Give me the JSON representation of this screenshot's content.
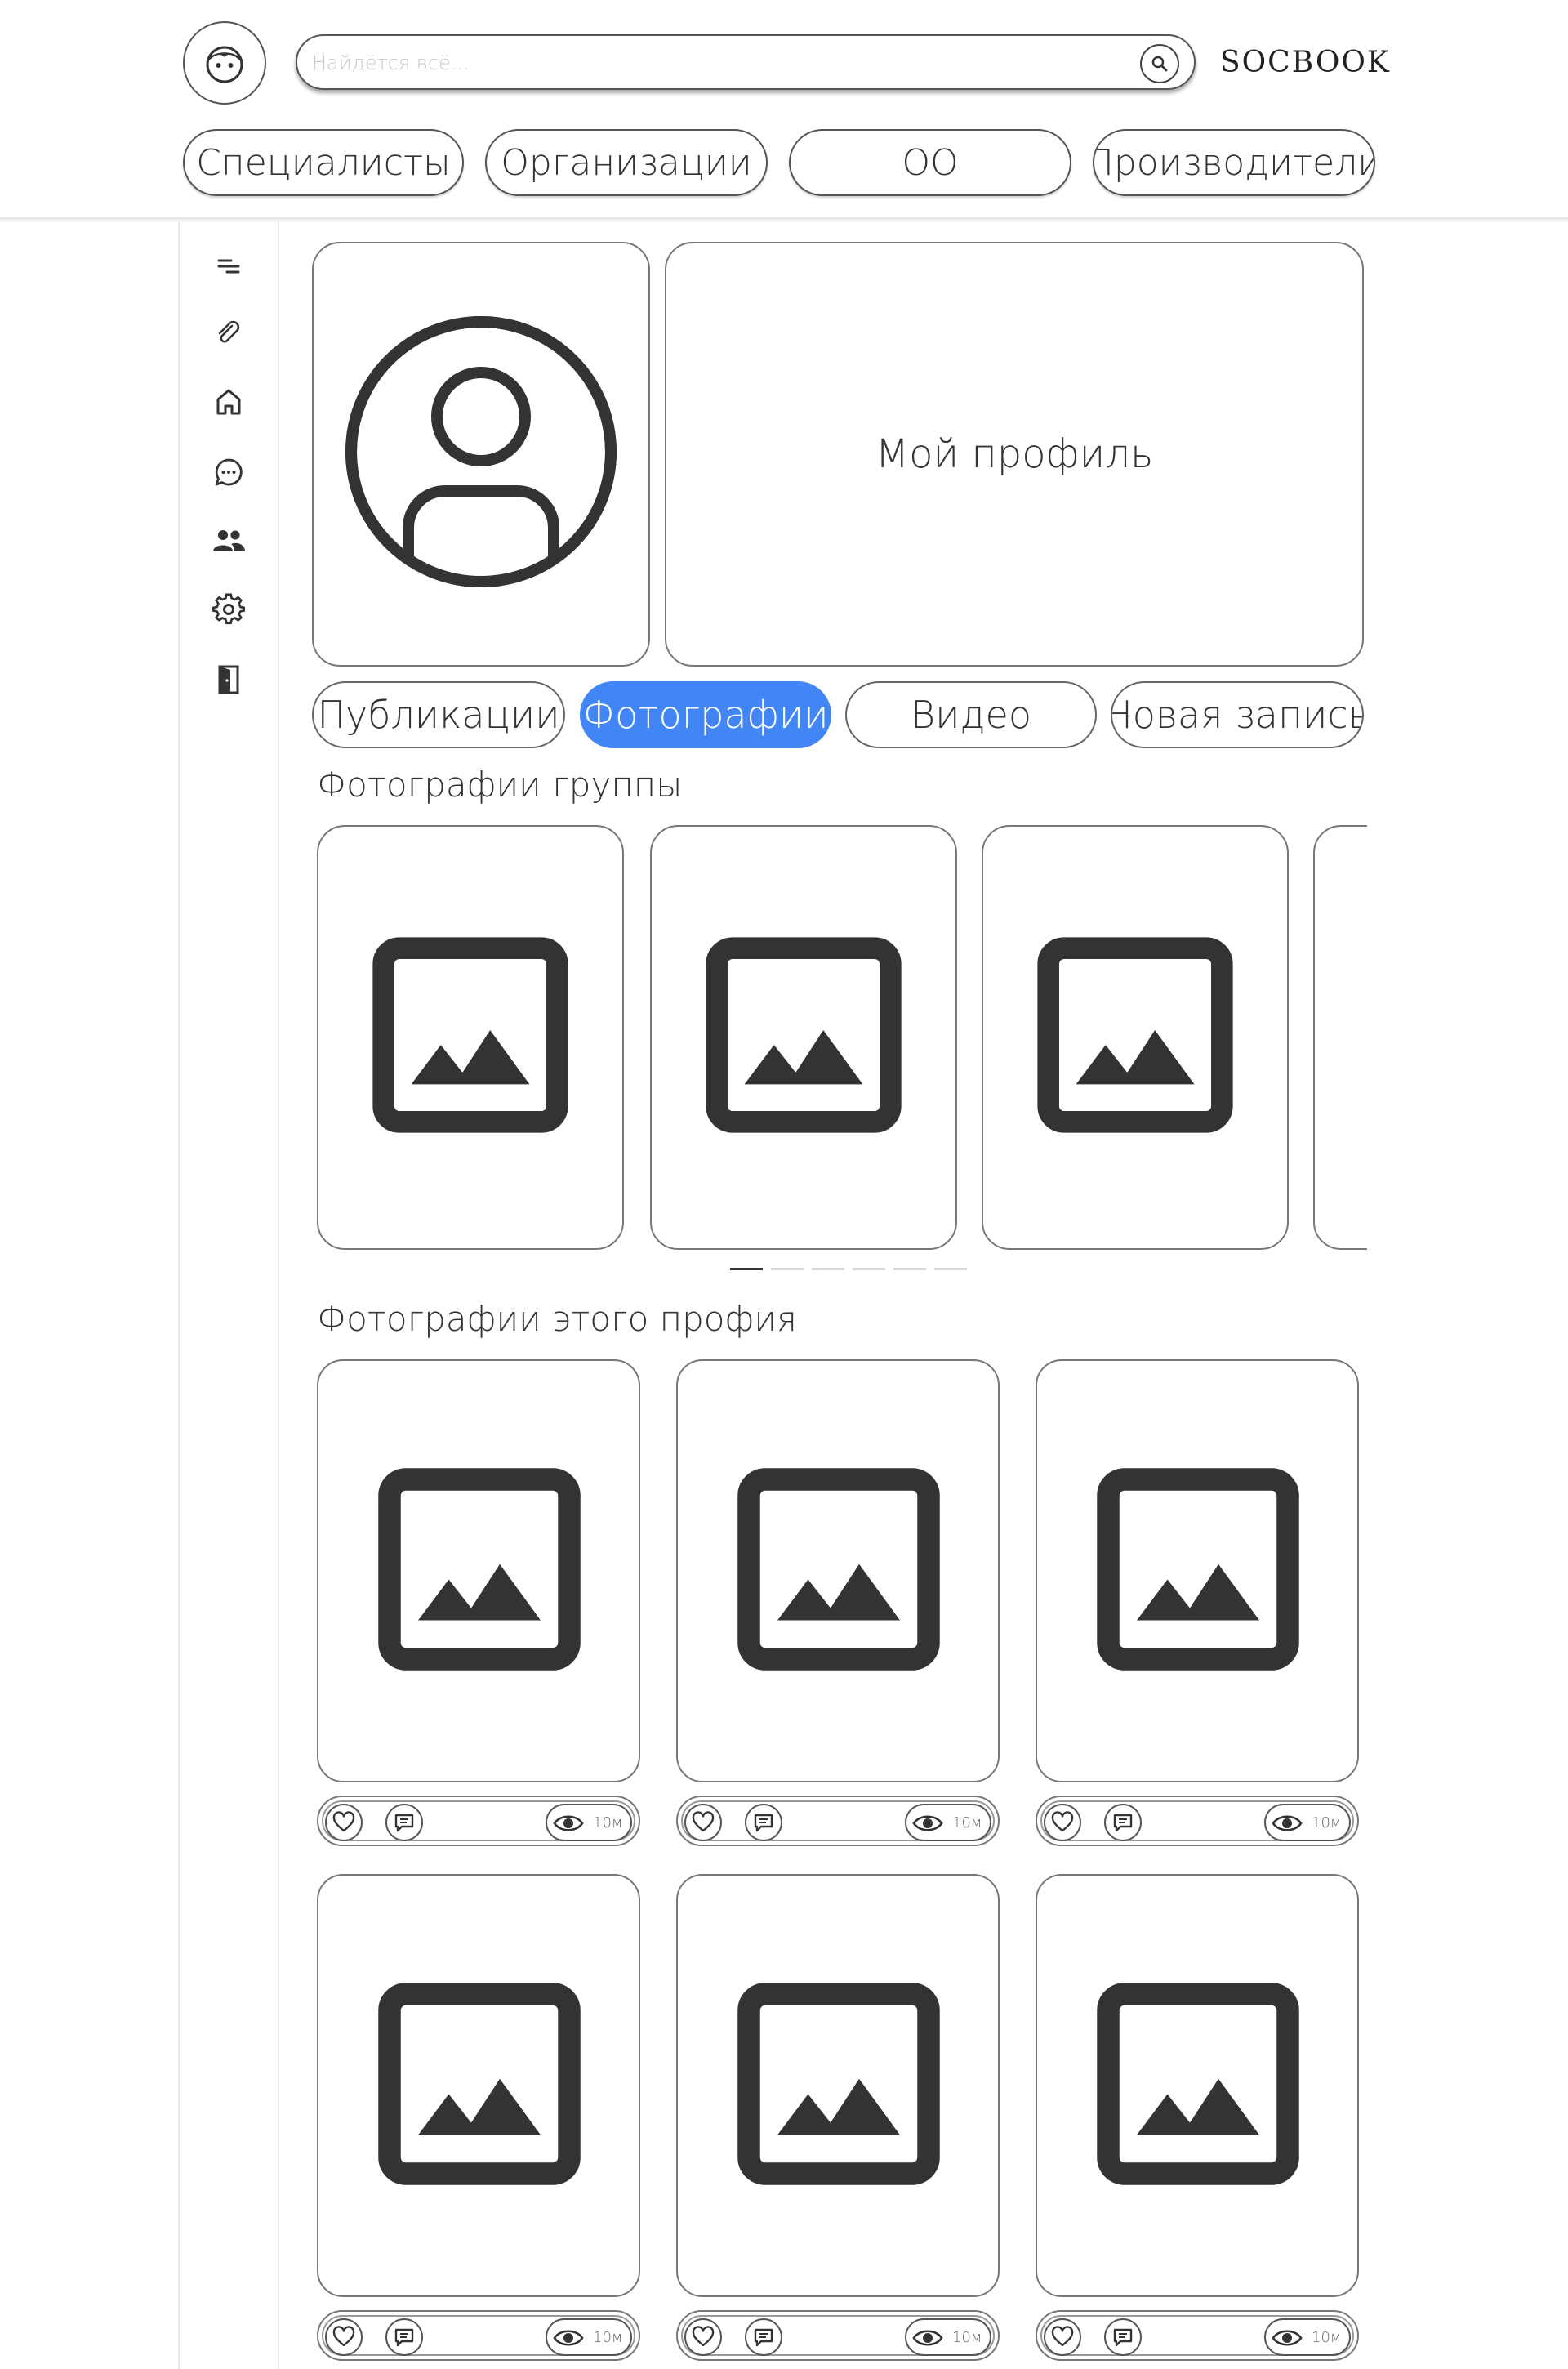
{
  "header": {
    "logo_icon": "face-icon",
    "search_placeholder": "Найдётся всё...",
    "search_icon": "search-icon",
    "brand": "SOCBOOK",
    "categories": [
      "Специалисты",
      "Организации",
      "ОО",
      "Производители"
    ]
  },
  "sidebar": {
    "items": [
      {
        "icon": "menu-lines-icon"
      },
      {
        "icon": "paperclip-icon"
      },
      {
        "icon": "home-icon"
      },
      {
        "icon": "chat-icon"
      },
      {
        "icon": "people-icon"
      },
      {
        "icon": "settings-gear-icon"
      },
      {
        "icon": "exit-door-icon"
      }
    ]
  },
  "profile": {
    "avatar_icon": "user-avatar-icon",
    "title": "Мой профиль",
    "tabs": [
      "Публикации",
      "Фотографии",
      "Видео",
      "Новая запись"
    ],
    "active_tab": "Фотографии"
  },
  "group_photos": {
    "title": "Фотографии группы",
    "visible_items": 4,
    "dots_total": 6,
    "dots_active_index": 0
  },
  "profile_photos": {
    "title": "Фотографии этого профия",
    "items": [
      {
        "views": "10м"
      },
      {
        "views": "10м"
      },
      {
        "views": "10м"
      },
      {
        "views": "10м"
      },
      {
        "views": "10м"
      },
      {
        "views": "10м"
      }
    ]
  },
  "colors": {
    "accent": "#4286f5",
    "icon": "#333333",
    "border": "#777777"
  }
}
